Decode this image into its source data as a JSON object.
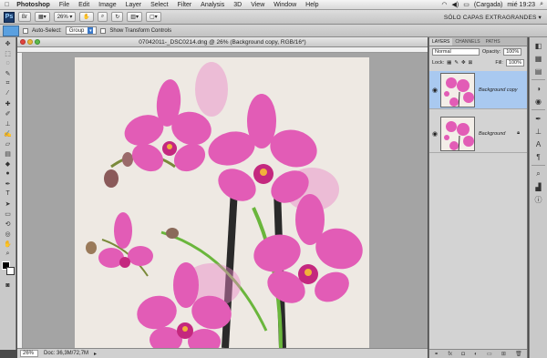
{
  "menu": {
    "app": "Photoshop",
    "items": [
      "File",
      "Edit",
      "Image",
      "Layer",
      "Select",
      "Filter",
      "Analysis",
      "3D",
      "View",
      "Window",
      "Help"
    ],
    "battery": "(Cargada)",
    "clock": "mié 19:23"
  },
  "appbar": {
    "logo": "Ps",
    "zoom": "26%",
    "workspace": "SÓLO CAPAS EXTRAGRANDES"
  },
  "options": {
    "auto_select_label": "Auto-Select:",
    "auto_select_value": "Group",
    "transform_label": "Show Transform Controls"
  },
  "document": {
    "title": "07042011-_DSC0214.dng @ 26% (Background copy, RGB/16*)",
    "status_zoom": "26%",
    "status_doc": "Doc: 36,3M/72,7M"
  },
  "layers_panel": {
    "tabs": [
      "LAYERS",
      "CHANNELS",
      "PATHS"
    ],
    "blend_mode": "Normal",
    "opacity_label": "Opacity:",
    "opacity": "100%",
    "lock_label": "Lock:",
    "fill_label": "Fill:",
    "fill": "100%",
    "layers": [
      {
        "name": "Background copy",
        "active": true
      },
      {
        "name": "Background",
        "active": false
      }
    ]
  },
  "colors": {
    "selection": "#a9c9f0",
    "petal": "#e25cb6",
    "petal_dark": "#c4287f",
    "stem": "#2d2d2d",
    "green": "#6ab63c"
  }
}
